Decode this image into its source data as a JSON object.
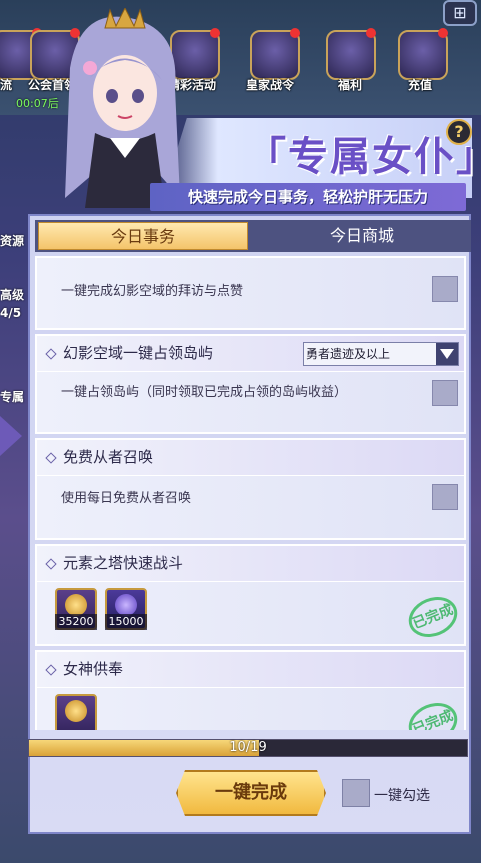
{
  "hud": {
    "items": [
      {
        "label": "流",
        "icon": "gift-icon"
      },
      {
        "label": "公会首领",
        "icon": "guild-boss-icon"
      },
      {
        "label": "精彩活动",
        "icon": "star-event-icon"
      },
      {
        "label": "皇家战令",
        "icon": "royal-pass-icon"
      },
      {
        "label": "福利",
        "icon": "welfare-gift-icon"
      },
      {
        "label": "充值",
        "icon": "diamond-recharge-icon"
      }
    ],
    "timer": "00:07后",
    "side_labels": [
      "资源",
      "高级",
      "4/5",
      "专属"
    ]
  },
  "title": {
    "main": "「专属女仆」",
    "subtitle": "快速完成今日事务，轻松护肝无压力",
    "help": "?"
  },
  "tabs": [
    {
      "label": "今日事务",
      "active": true
    },
    {
      "label": "今日商城",
      "active": false
    }
  ],
  "tasks": [
    {
      "title": "",
      "desc": "一键完成幻影空域的拜访与点赞",
      "checked": false
    },
    {
      "title": "幻影空域一键占领岛屿",
      "dropdown": "勇者遗迹及以上",
      "desc": "一键占领岛屿（同时领取已完成占领的岛屿收益）",
      "checked": false
    },
    {
      "title": "免费从者召唤",
      "desc": "使用每日免费从者召唤",
      "checked": false
    },
    {
      "title": "元素之塔快速战斗",
      "items": [
        {
          "qty": "35200",
          "icon": "gold-emblem-icon"
        },
        {
          "qty": "15000",
          "icon": "purple-emblem-icon"
        }
      ],
      "stamp": "已完成"
    },
    {
      "title": "女神供奉",
      "items": [
        {
          "qty": "",
          "icon": "gold-emblem-icon"
        }
      ],
      "stamp": "已完成"
    }
  ],
  "progress": {
    "text": "10/19",
    "value": 0.526
  },
  "footer": {
    "main_button": "一键完成",
    "check_all": "一键勾选"
  },
  "colors": {
    "accent": "#6a50c6",
    "gold": "#f1b93f",
    "done": "#3fb565"
  }
}
